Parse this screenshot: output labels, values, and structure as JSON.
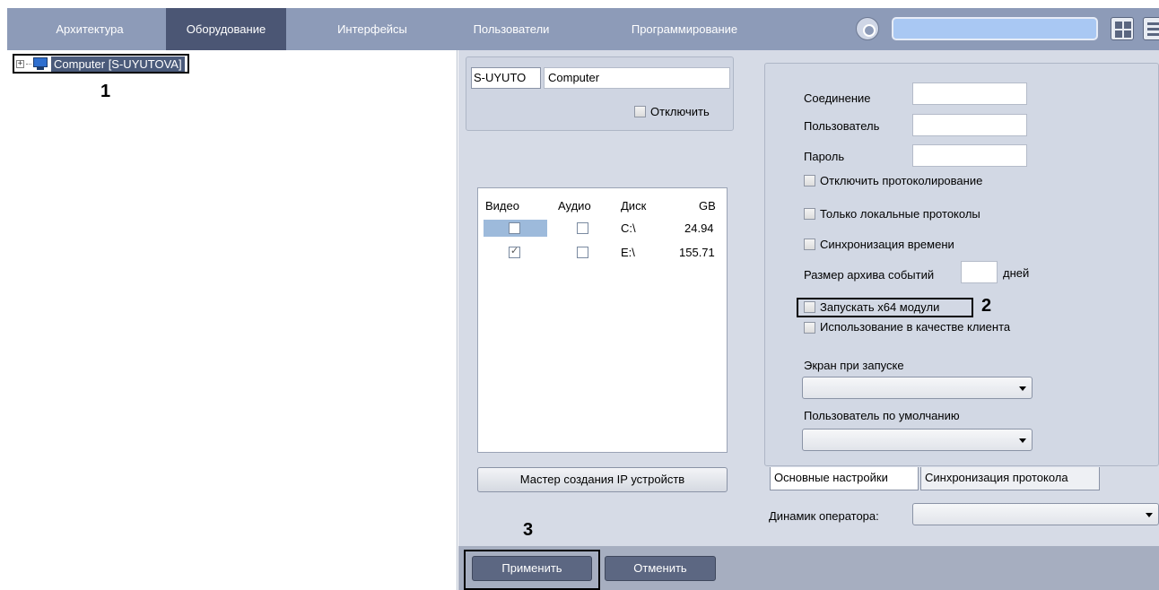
{
  "nav": {
    "tabs": [
      "Архитектура",
      "Оборудование",
      "Интерфейсы",
      "Пользователи",
      "Программирование"
    ],
    "active_tab": "Оборудование"
  },
  "tree": {
    "expander": "+",
    "node_label": "Computer [S-UYUTOVA]"
  },
  "markers": {
    "m1": "1",
    "m2": "2",
    "m3": "3"
  },
  "computer": {
    "id": "S-UYUTO",
    "name": "Computer",
    "disable_label": "Отключить"
  },
  "disks": {
    "headers": [
      "Видео",
      "Аудио",
      "Диск",
      "GB"
    ],
    "rows": [
      {
        "video": false,
        "audio": false,
        "disk": "C:\\",
        "gb": "24.94"
      },
      {
        "video": true,
        "audio": false,
        "disk": "E:\\",
        "gb": "155.71"
      }
    ]
  },
  "ip_wizard_label": "Мастер создания IP устройств",
  "settings": {
    "connection_label": "Соединение",
    "user_label": "Пользователь",
    "password_label": "Пароль",
    "disable_logging_label": "Отключить протоколирование",
    "local_logs_label": "Только локальные протоколы",
    "time_sync_label": "Синхронизация времени",
    "archive_size_label": "Размер архива событий",
    "days_label": "дней",
    "x64_label": "Запускать x64 модули",
    "client_label": "Использование в качестве клиента",
    "startup_screen_label": "Экран при запуске",
    "default_user_label": "Пользователь по умолчанию",
    "tab_main": "Основные настройки",
    "tab_sync": "Синхронизация протокола",
    "speaker_label": "Динамик оператора:"
  },
  "footer": {
    "apply_label": "Применить",
    "cancel_label": "Отменить"
  }
}
